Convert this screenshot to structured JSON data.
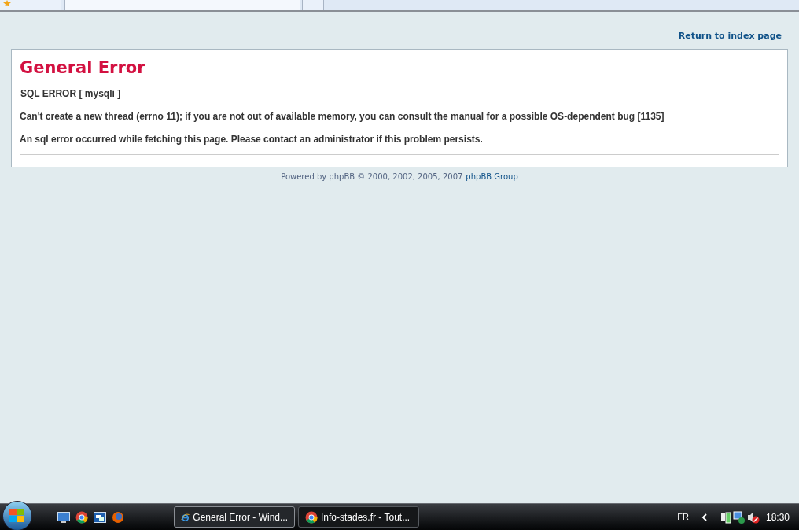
{
  "page": {
    "return_link": "Return to index page",
    "title": "General Error",
    "messages": [
      "SQL ERROR [ mysqli ]",
      "Can't create a new thread (errno 11); if you are not out of available memory, you can consult the manual for a possible OS-dependent bug [1135]",
      "An sql error occurred while fetching this page. Please contact an administrator if this problem persists."
    ],
    "footer": {
      "text": "Powered by phpBB © 2000, 2002, 2005, 2007",
      "link": "phpBB Group"
    }
  },
  "taskbar": {
    "windows": [
      {
        "kind": "ie",
        "label": "General Error - Wind...",
        "selected": true
      },
      {
        "kind": "chrome",
        "label": "Info-stades.fr - Tout...",
        "selected": false
      }
    ],
    "language": "FR",
    "clock": "18:30"
  }
}
